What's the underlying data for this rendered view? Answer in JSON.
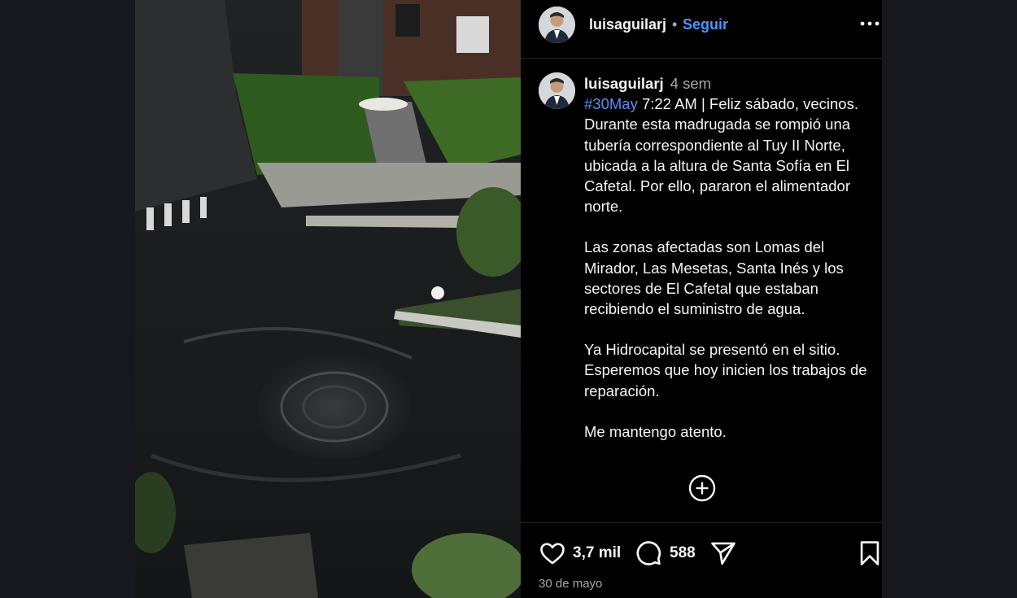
{
  "post": {
    "username": "luisaguilarj",
    "dot": "•",
    "follow_label": "Seguir",
    "caption": {
      "username": "luisaguilarj",
      "time_ago": "4 sem",
      "hashtag": "#30May",
      "line_1_rest": " 7:22 AM | Feliz sábado, vecinos. Durante esta madrugada se rompió una tubería correspondiente al Tuy II Norte, ubicada a la altura de Santa Sofía en El Cafetal. Por ello, pararon el alimentador norte.",
      "paragraph_2": "Las zonas afectadas son Lomas del Mirador, Las Mesetas, Santa Inés y los sectores de El Cafetal que estaban recibiendo el suministro de agua.",
      "paragraph_3": "Ya Hidrocapital se presentó en el sitio. Esperemos que hoy inicien los trabajos de reparación.",
      "paragraph_4": "Me mantengo atento."
    },
    "likes": "3,7 mil",
    "comments": "588",
    "date": "30 de mayo"
  },
  "icons": {
    "more": "more-options-icon",
    "add_comment": "plus-circle-icon",
    "like": "heart-icon",
    "comment": "comment-icon",
    "share": "send-icon",
    "save": "bookmark-icon"
  },
  "colors": {
    "background": "#16181d",
    "panel": "#000000",
    "follow_blue": "#4a96ff",
    "hashtag_blue": "#5b8def",
    "muted": "#a8a8a8"
  }
}
